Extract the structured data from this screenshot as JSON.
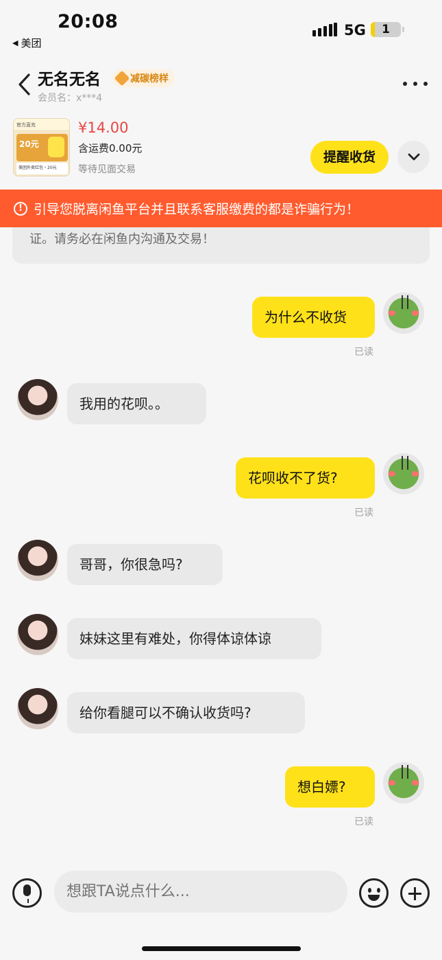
{
  "status_bar": {
    "time": "20:08",
    "back_app": "美团",
    "network": "5G",
    "battery": "1"
  },
  "header": {
    "name": "无名无名",
    "badge": "减碳榜样",
    "member": "会员名：x***4"
  },
  "product": {
    "thumb_top": "官方直充",
    "thumb_price": "20元",
    "thumb_bottom": "美团外卖红包・20元",
    "price": "¥14.00",
    "shipping": "含运费0.00元",
    "trade": "等待见面交易",
    "remind_label": "提醒收货"
  },
  "warning": {
    "text": "引导您脱离闲鱼平台并且联系客服缴费的都是诈骗行为！",
    "icon": "!"
  },
  "notice": {
    "text": "证。请务必在闲鱼内沟通及交易！"
  },
  "messages": [
    {
      "from": "me",
      "text": "为什么不收货",
      "status": "已读"
    },
    {
      "from": "her",
      "text": "我用的花呗。。"
    },
    {
      "from": "me",
      "text": "花呗收不了货?",
      "status": "已读"
    },
    {
      "from": "her",
      "text": "哥哥，你很急吗?"
    },
    {
      "from": "her",
      "text": "妹妹这里有难处，你得体谅体谅"
    },
    {
      "from": "her",
      "text": "给你看腿可以不确认收货吗?"
    },
    {
      "from": "me",
      "text": "想白嫖?",
      "status": "已读"
    }
  ],
  "input": {
    "placeholder": "想跟TA说点什么..."
  },
  "colors": {
    "accent_yellow": "#ffe11a",
    "warning_orange": "#ff5b2e",
    "price_red": "#e84545"
  }
}
